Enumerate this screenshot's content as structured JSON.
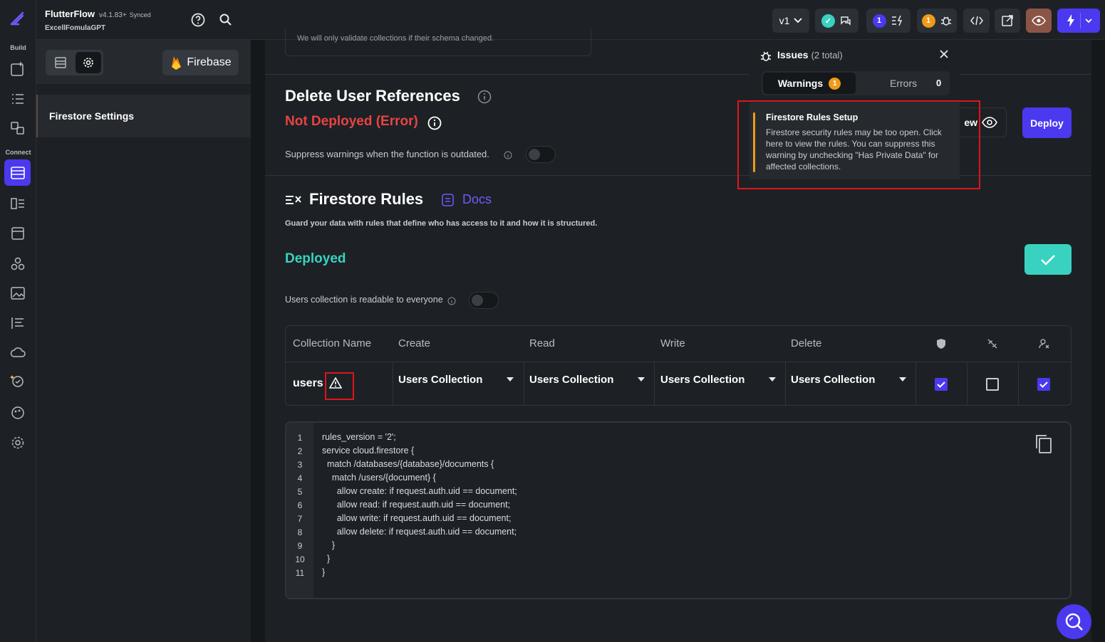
{
  "app": {
    "name": "FlutterFlow",
    "version": "v4.1.83+",
    "sync": "Synced",
    "project": "ExcellFomulaGPT"
  },
  "rail": {
    "build_label": "Build",
    "connect_label": "Connect"
  },
  "topbar": {
    "branch": "v1",
    "warnings_count": "1",
    "bugs_count": "1",
    "brand_color": "#4b39ef"
  },
  "panel": {
    "firebase_label": "Firebase",
    "nav_item": "Firestore Settings"
  },
  "top_hint": "We will only validate collections if their schema changed.",
  "delete_refs": {
    "title": "Delete User References",
    "status": "Not Deployed (Error)",
    "status_color": "#e84343",
    "suppress_label": "Suppress warnings when the function is outdated.",
    "view_label": "ew",
    "deploy_label": "Deploy"
  },
  "rules": {
    "title": "Firestore Rules",
    "docs_label": "Docs",
    "subtitle": "Guard your data with rules that define who has access to it and how it is structured.",
    "status": "Deployed",
    "status_color": "#39d2c0",
    "readable_label": "Users collection is readable to everyone"
  },
  "table": {
    "headers": [
      "Collection Name",
      "Create",
      "Read",
      "Write",
      "Delete"
    ],
    "row": {
      "name": "users",
      "create": "Users Collection",
      "read": "Users Collection",
      "write": "Users Collection",
      "delete": "Users Collection",
      "private_data": true,
      "no_auth": false,
      "user_owned": true
    }
  },
  "code": {
    "line_numbers": [
      "1",
      "2",
      "3",
      "4",
      "5",
      "6",
      "7",
      "8",
      "9",
      "10",
      "11"
    ],
    "lines": [
      "rules_version = '2';",
      "service cloud.firestore {",
      "  match /databases/{database}/documents {",
      "    match /users/{document} {",
      "      allow create: if request.auth.uid == document;",
      "      allow read: if request.auth.uid == document;",
      "      allow write: if request.auth.uid == document;",
      "      allow delete: if request.auth.uid == document;",
      "    }",
      "  }",
      "}"
    ]
  },
  "issues": {
    "title": "Issues",
    "total": "(2 total)",
    "warnings_tab": "Warnings",
    "warnings_count": "1",
    "errors_tab": "Errors",
    "errors_count": "0",
    "card_title": "Firestore Rules Setup",
    "card_text": "Firestore security rules may be too open. Click here to view the rules. You can suppress this warning by unchecking \"Has Private Data\" for affected collections."
  }
}
